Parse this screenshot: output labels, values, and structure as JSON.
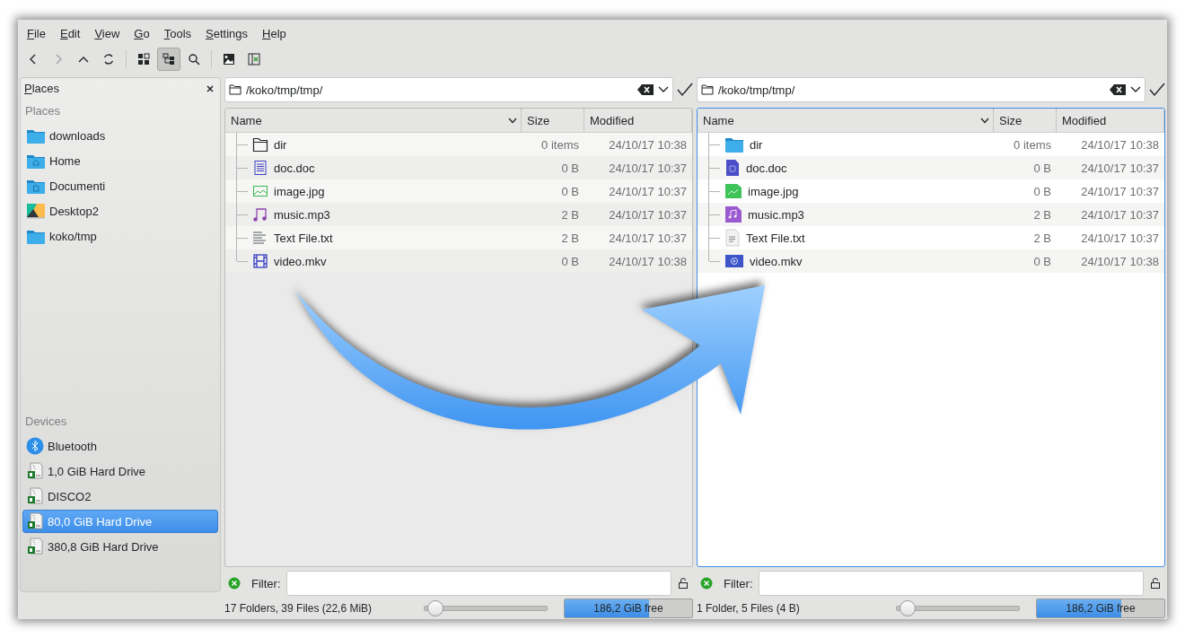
{
  "menu": [
    "File",
    "Edit",
    "View",
    "Go",
    "Tools",
    "Settings",
    "Help"
  ],
  "toolbar": {
    "navigation": [
      {
        "kind": "back",
        "disabled": false
      },
      {
        "kind": "forward",
        "disabled": true
      },
      {
        "kind": "up",
        "disabled": false
      },
      {
        "kind": "reload",
        "disabled": false
      }
    ],
    "view_modes": [
      {
        "kind": "icons-view",
        "selected": false
      },
      {
        "kind": "tree-view",
        "selected": true
      }
    ],
    "tools": [
      {
        "kind": "search"
      },
      {
        "kind": "preview"
      },
      {
        "kind": "split"
      }
    ]
  },
  "sidebar": {
    "title": "Places",
    "sections": [
      {
        "heading": "Places",
        "items": [
          {
            "label": "downloads",
            "kind": "folder",
            "selected": false
          },
          {
            "label": "Home",
            "kind": "home",
            "selected": false
          },
          {
            "label": "Documenti",
            "kind": "documents",
            "selected": false
          },
          {
            "label": "Desktop2",
            "kind": "desktop",
            "selected": false
          },
          {
            "label": "koko/tmp",
            "kind": "folder",
            "selected": false
          }
        ]
      },
      {
        "heading": "Devices",
        "items": [
          {
            "label": "Bluetooth",
            "kind": "bluetooth",
            "selected": false
          },
          {
            "label": "1,0 GiB Hard Drive",
            "kind": "drive",
            "selected": false
          },
          {
            "label": "DISCO2",
            "kind": "drive",
            "selected": false
          },
          {
            "label": "80,0 GiB Hard Drive",
            "kind": "drive",
            "selected": true
          },
          {
            "label": "380,8 GiB Hard Drive",
            "kind": "drive",
            "selected": false
          }
        ]
      }
    ]
  },
  "panes": [
    {
      "active": false,
      "kind": "line",
      "path": "/koko/tmp/tmp/",
      "columns": [
        "Name",
        "Size",
        "Modified"
      ],
      "files": [
        {
          "name": "dir",
          "kind": "folder",
          "size": "0 items",
          "modified": "24/10/17 10:38"
        },
        {
          "name": "doc.doc",
          "kind": "document",
          "size": "0 B",
          "modified": "24/10/17 10:37"
        },
        {
          "name": "image.jpg",
          "kind": "image",
          "size": "0 B",
          "modified": "24/10/17 10:37"
        },
        {
          "name": "music.mp3",
          "kind": "audio",
          "size": "2 B",
          "modified": "24/10/17 10:37"
        },
        {
          "name": "Text File.txt",
          "kind": "text",
          "size": "2 B",
          "modified": "24/10/17 10:37"
        },
        {
          "name": "video.mkv",
          "kind": "video",
          "size": "0 B",
          "modified": "24/10/17 10:38"
        }
      ],
      "filter_label": "Filter:",
      "status": "17 Folders, 39 Files (22,6 MiB)",
      "zoom": {
        "level": 0.08
      },
      "free_space": {
        "text": "186,2 GiB free",
        "level": 0.66
      }
    },
    {
      "active": true,
      "kind": "color",
      "path": "/koko/tmp/tmp/",
      "columns": [
        "Name",
        "Size",
        "Modified"
      ],
      "files": [
        {
          "name": "dir",
          "kind": "folder",
          "size": "0 items",
          "modified": "24/10/17 10:38"
        },
        {
          "name": "doc.doc",
          "kind": "document",
          "size": "0 B",
          "modified": "24/10/17 10:37"
        },
        {
          "name": "image.jpg",
          "kind": "image",
          "size": "0 B",
          "modified": "24/10/17 10:37"
        },
        {
          "name": "music.mp3",
          "kind": "audio",
          "size": "2 B",
          "modified": "24/10/17 10:37"
        },
        {
          "name": "Text File.txt",
          "kind": "text",
          "size": "2 B",
          "modified": "24/10/17 10:37"
        },
        {
          "name": "video.mkv",
          "kind": "video",
          "size": "0 B",
          "modified": "24/10/17 10:38"
        }
      ],
      "filter_label": "Filter:",
      "status": "1 Folder, 5 Files (4 B)",
      "zoom": {
        "level": 0.08
      },
      "free_space": {
        "text": "186,2 GiB free",
        "level": 0.66
      }
    }
  ],
  "overlay": {
    "kind": "arrow"
  }
}
